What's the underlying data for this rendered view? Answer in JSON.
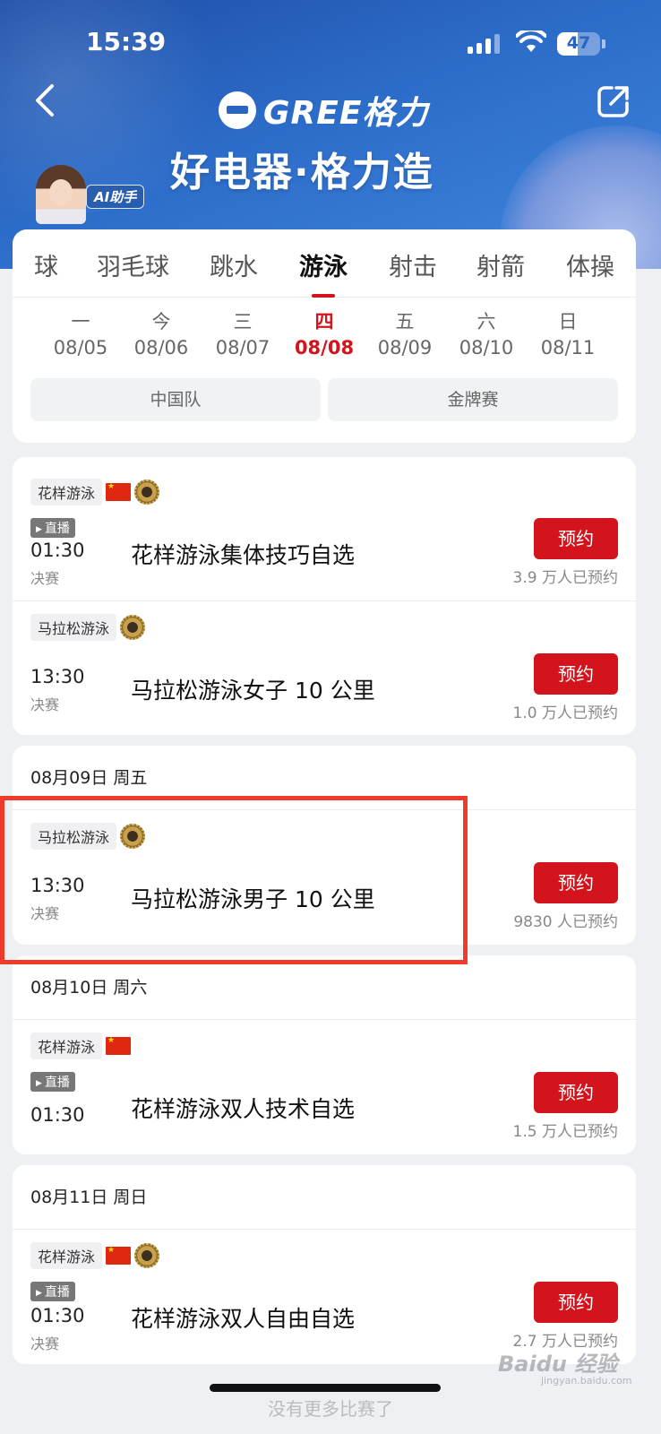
{
  "status_bar": {
    "time": "15:39",
    "battery": "47",
    "battery_level": 0.47
  },
  "header": {
    "brand_name": "GREE格力",
    "slogan": "好电器·格力造",
    "ai_badge": "AI助手",
    "back_icon": "chevron-left-icon",
    "share_icon": "share-icon"
  },
  "sport_tabs": [
    {
      "label": "球",
      "active": false
    },
    {
      "label": "羽毛球",
      "active": false
    },
    {
      "label": "跳水",
      "active": false
    },
    {
      "label": "游泳",
      "active": true
    },
    {
      "label": "射击",
      "active": false
    },
    {
      "label": "射箭",
      "active": false
    },
    {
      "label": "体操",
      "active": false
    }
  ],
  "days": [
    {
      "weekday": "一",
      "date": "08/05",
      "active": false
    },
    {
      "weekday": "今",
      "date": "08/06",
      "active": false
    },
    {
      "weekday": "三",
      "date": "08/07",
      "active": false
    },
    {
      "weekday": "四",
      "date": "08/08",
      "active": true
    },
    {
      "weekday": "五",
      "date": "08/09",
      "active": false
    },
    {
      "weekday": "六",
      "date": "08/10",
      "active": false
    },
    {
      "weekday": "日",
      "date": "08/11",
      "active": false
    }
  ],
  "filters": [
    {
      "label": "中国队"
    },
    {
      "label": "金牌赛"
    }
  ],
  "reserve_label": "预约",
  "groups": [
    {
      "date_header": "",
      "events": [
        {
          "tag": "花样游泳",
          "china": true,
          "medal": true,
          "live": "直播",
          "time": "01:30",
          "round": "决赛",
          "title": "花样游泳集体技巧自选",
          "count": "3.9 万人已预约"
        },
        {
          "tag": "马拉松游泳",
          "china": false,
          "medal": true,
          "live": "",
          "time": "13:30",
          "round": "决赛",
          "title": "马拉松游泳女子 10 公里",
          "count": "1.0 万人已预约"
        }
      ]
    },
    {
      "date_header": "08月09日  周五",
      "events": [
        {
          "tag": "马拉松游泳",
          "china": false,
          "medal": true,
          "live": "",
          "time": "13:30",
          "round": "决赛",
          "title": "马拉松游泳男子 10 公里",
          "count": "9830 人已预约"
        }
      ]
    },
    {
      "date_header": "08月10日  周六",
      "events": [
        {
          "tag": "花样游泳",
          "china": true,
          "medal": false,
          "live": "直播",
          "time": "01:30",
          "round": "",
          "title": "花样游泳双人技术自选",
          "count": "1.5 万人已预约"
        }
      ]
    },
    {
      "date_header": "08月11日  周日",
      "events": [
        {
          "tag": "花样游泳",
          "china": true,
          "medal": true,
          "live": "直播",
          "time": "01:30",
          "round": "决赛",
          "title": "花样游泳双人自由自选",
          "count": "2.7 万人已预约"
        }
      ]
    }
  ],
  "footer_text": "没有更多比赛了",
  "watermark": "Baidu 经验",
  "watermark_sub": "jingyan.baidu.com",
  "colors": {
    "accent": "#d4141c",
    "header_blue": "#2c6cc9",
    "highlight": "#f23a2a"
  }
}
